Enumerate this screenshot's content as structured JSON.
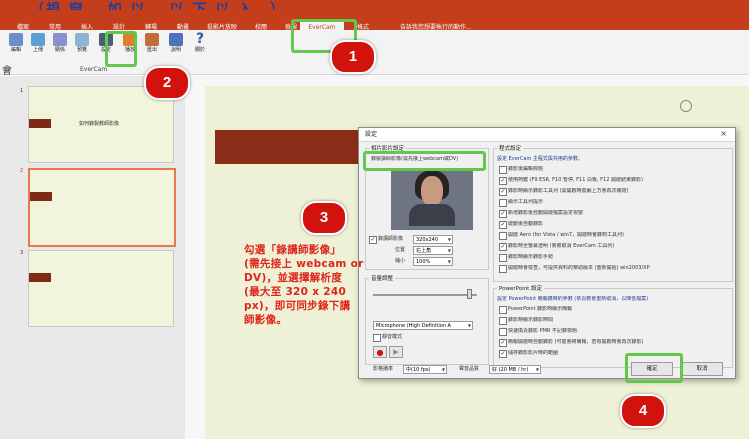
{
  "caption": {
    "text": "（視 窗 ，如 以 ，以 下 以 入 ，）"
  },
  "ribbon": {
    "tabs": [
      "檔案",
      "常用",
      "插入",
      "設計",
      "轉場",
      "動畫",
      "投影片放映",
      "校閱",
      "檢視",
      "EverCam",
      "格式"
    ],
    "active_tab": "EverCam",
    "tell_me": "告訴我您想要執行的動作...",
    "buttons": [
      "編輯",
      "上傳",
      "關係",
      "預覽",
      "設定",
      "播放",
      "匯出",
      "說明",
      "關於"
    ],
    "group_label": "EverCam",
    "icons": [
      "edit-icon",
      "upload-icon",
      "sort-icon",
      "preview-icon",
      "settings-icon",
      "play-icon",
      "export-icon",
      "zoom-icon",
      "help-icon"
    ]
  },
  "left_pane": {
    "slide_numbers": [
      "1",
      "2",
      "3"
    ],
    "slide1_title": "如何錄製教師影像",
    "side_char": "會"
  },
  "dialog": {
    "title": "設定",
    "close": "×",
    "video_group": "相片影片設定",
    "record_teacher": "錄製講師影像(需先接上webcam或DV)",
    "resolution_label": "錄講師影像",
    "resolution_value": "320x240",
    "position_label": "位置",
    "position_value": "右上角",
    "size_label": "縮小",
    "size_value": "100%",
    "audio_group": "音量調整",
    "mic_value": "Microphone (High Definition A",
    "mute_label": "靜音模式",
    "program_group": "程式設定",
    "program_desc": "設定 EverCam 主程式與共用的參數。",
    "program_options": [
      {
        "label": "錄影後編輯標題",
        "checked": false
      },
      {
        "label": "使用熱鍵 (F9 ESR, F10 暫停, F11 白板, F12 開啟結束錄影)",
        "checked": true
      },
      {
        "label": "錄影時顯示錄影工具列 (需開啟時置顯上方會再次關閉)",
        "checked": true
      },
      {
        "label": "顯示工具列提示",
        "checked": false
      },
      {
        "label": "新增錄影後自動開啟檔案設定視窗",
        "checked": true
      },
      {
        "label": "啟動後自動錄影",
        "checked": true
      },
      {
        "label": "開啟 Aero (for Vista / win7，開啟時會錄到工具列)",
        "checked": false
      },
      {
        "label": "錄影時全螢幕透明 (會被取消 EverCam 工具列)",
        "checked": true
      },
      {
        "label": "錄影時顯示錄影手勢",
        "checked": false
      },
      {
        "label": "開啟時會檢查，可提供資料的幫助版本 (重新開始) win2003/XP",
        "checked": false
      }
    ],
    "ppt_group": "PowerPoint 設定",
    "ppt_desc": "設定 PowerPoint 簡報錄時的參數 (依頁數會重新取消，以降低檔案)",
    "ppt_options": [
      {
        "label": "PowerPoint 錄影時顯示簡報",
        "checked": false
      },
      {
        "label": "錄影時顯示錄影時間",
        "checked": false
      },
      {
        "label": "快速換頁錄影 PMR 不記錄標題",
        "checked": false
      },
      {
        "label": "簡報開啟時自動錄影 (可能會將簡報，若有開啟時會再次錄影)",
        "checked": true
      },
      {
        "label": "儲存錄影影片時的範圍",
        "checked": true
      }
    ],
    "fps_label": "影格播率",
    "fps_value": "中(10 fps)",
    "quality_label": "聲音品質",
    "quality_value": "好 (20 MB / hr)",
    "ok": "確定",
    "cancel": "取消"
  },
  "annotation": {
    "lines": [
      "勾選「錄講師影像」",
      "(需先接上 webcam or",
      "DV)，並選擇解析度",
      "(最大至 320 x 240",
      "px)，即可同步錄下講",
      "師影像。"
    ]
  },
  "badges": [
    "1",
    "2",
    "3",
    "4"
  ],
  "colors": {
    "ppt_red": "#c43e1c",
    "highlight_green": "#62c84a",
    "badge_red": "#d1120d",
    "annotation_red": "#e0241b",
    "caption_blue": "#1a3fa0"
  }
}
